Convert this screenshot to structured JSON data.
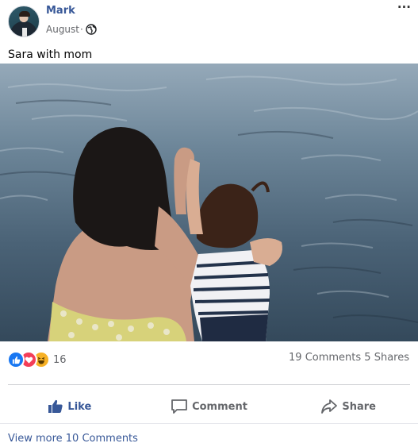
{
  "post": {
    "author": "Mark",
    "timestamp": "August",
    "separator": "·",
    "privacy_icon": "globe-icon",
    "more_label": "···",
    "caption": "Sara with mom",
    "photo_alt": "Sara with mom"
  },
  "engagement": {
    "reaction_icons": [
      "like-reaction-icon",
      "love-reaction-icon",
      "haha-reaction-icon"
    ],
    "reaction_count": "16",
    "comments": "19 Comments",
    "shares": "5 Shares"
  },
  "actions": {
    "like": "Like",
    "comment": "Comment",
    "share": "Share"
  },
  "footer": {
    "view_more": "View more 10 Comments"
  },
  "colors": {
    "link_blue": "#385898",
    "like_blue": "#1877f2",
    "love_red": "#f33e58",
    "haha_yellow": "#f7b125",
    "muted_gray": "#65676b"
  }
}
